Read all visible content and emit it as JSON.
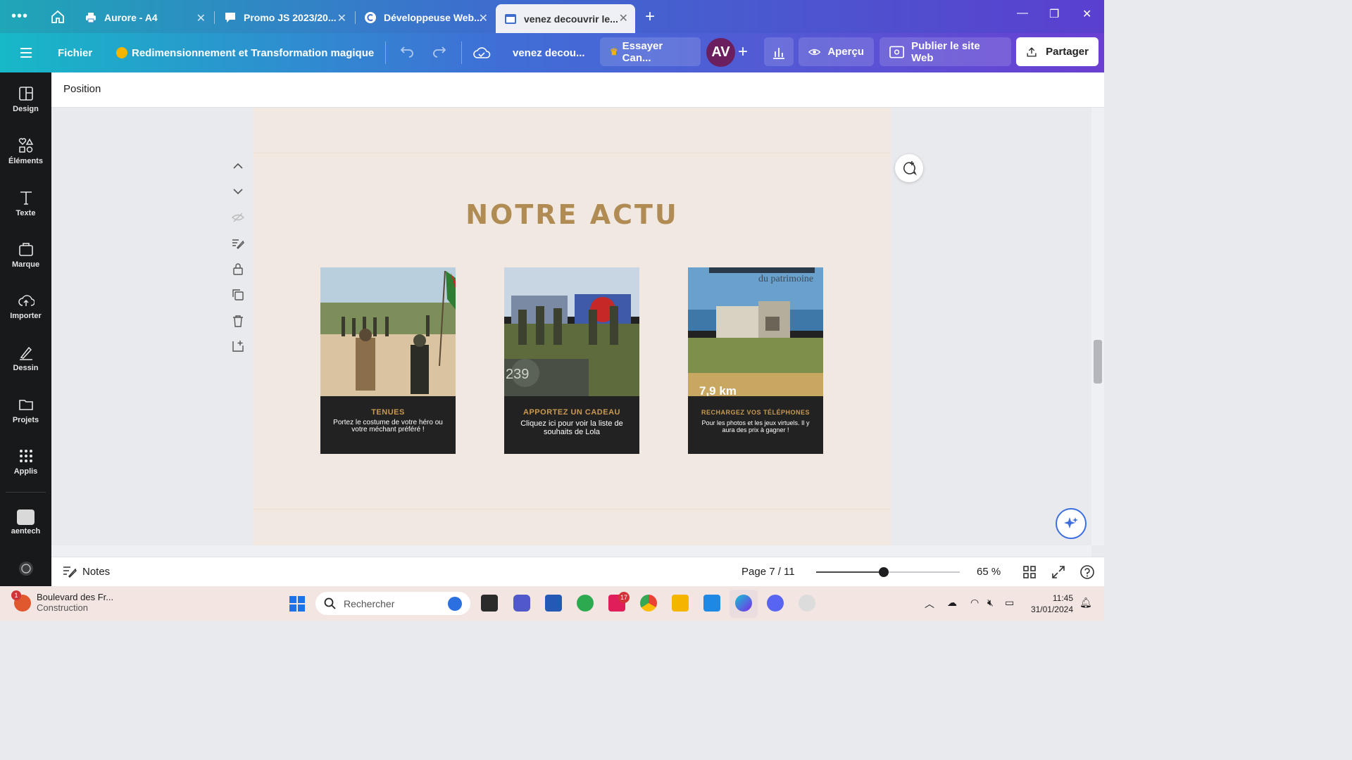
{
  "browser": {
    "tabs": [
      {
        "label": "Aurore - A4",
        "icon": "printer-icon"
      },
      {
        "label": "Promo JS 2023/20...",
        "icon": "chat-icon"
      },
      {
        "label": "Développeuse Web...",
        "icon": "site-icon"
      },
      {
        "label": "venez decouvrir le...",
        "icon": "calendar-icon",
        "active": true
      }
    ]
  },
  "toolbar": {
    "file": "Fichier",
    "resize": "Redimensionnement et Transformation magique",
    "doc_title": "venez decou...",
    "try_canva": "Essayer Can...",
    "avatar": "AV",
    "preview": "Aperçu",
    "publish": "Publier le site Web",
    "share": "Partager"
  },
  "sidebar": {
    "items": [
      {
        "label": "Design",
        "icon": "layout-icon"
      },
      {
        "label": "Éléments",
        "icon": "shapes-icon"
      },
      {
        "label": "Texte",
        "icon": "text-icon"
      },
      {
        "label": "Marque",
        "icon": "brand-icon"
      },
      {
        "label": "Importer",
        "icon": "upload-icon"
      },
      {
        "label": "Dessin",
        "icon": "draw-icon"
      },
      {
        "label": "Projets",
        "icon": "folder-icon"
      },
      {
        "label": "Applis",
        "icon": "apps-icon"
      },
      {
        "label": "aentech",
        "icon": "team-icon"
      }
    ]
  },
  "position_bar": {
    "label": "Position"
  },
  "page": {
    "heading": "NOTRE ACTU",
    "cards": [
      {
        "title": "TENUES",
        "text": "Portez le costume de votre héro ou votre méchant préféré !"
      },
      {
        "title": "APPORTEZ UN CADEAU",
        "text": "Cliquez ici pour voir la liste de souhaits de Lola"
      },
      {
        "title": "RECHARGEZ VOS TÉLÉPHONES",
        "text": "Pour les photos et les jeux virtuels. Il y aura des prix à gagner !",
        "photo_caption": "du patrimoine",
        "photo_corner": "7,9 km"
      }
    ],
    "photo2_number": "239"
  },
  "bottom": {
    "notes": "Notes",
    "page_label": "Page 7 / 11",
    "zoom": "65 %",
    "zoom_fraction": 0.47
  },
  "taskbar": {
    "weather_title": "Boulevard des Fr...",
    "weather_sub": "Construction",
    "weather_badge": "1",
    "search_placeholder": "Rechercher",
    "app_badge": "17",
    "time": "11:45",
    "date": "31/01/2024"
  },
  "colors": {
    "accent_gold": "#b08b53",
    "card_dark": "#222222",
    "page_bg": "#f0e8e1"
  }
}
